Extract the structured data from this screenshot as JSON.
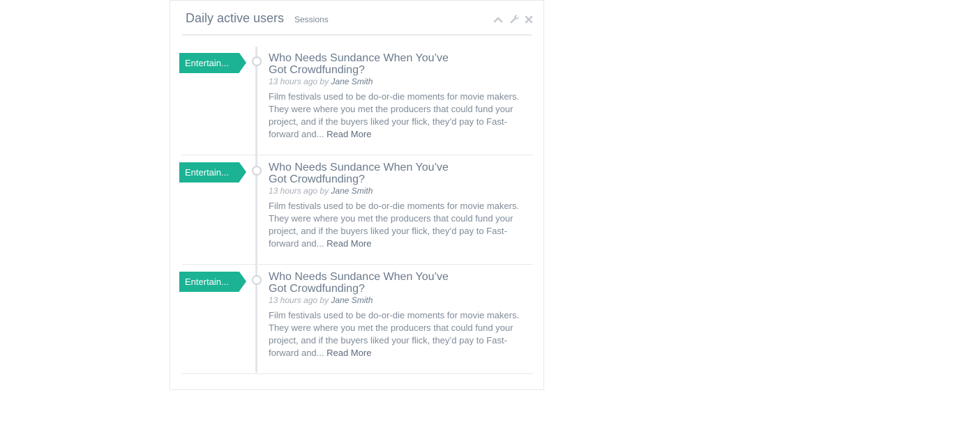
{
  "widget": {
    "title": "Daily active users",
    "subtitle": "Sessions",
    "tools": [
      "chevron-up-icon",
      "wrench-icon",
      "close-icon"
    ]
  },
  "colors": {
    "tag": "#1bb394",
    "text": "#6b7a8c",
    "muted": "#a7aeb6"
  },
  "entries": [
    {
      "tag": "Entertain...",
      "title": "Who Needs Sundance When You’ve Got Crowdfunding?",
      "time": "13 hours ago by ",
      "author": "Jane Smith",
      "text": "Film festivals used to be do-or-die moments for movie makers. They were where you met the producers that could fund your project, and if the buyers liked your flick, they’d pay to Fast-forward and... ",
      "read_more": "Read More"
    },
    {
      "tag": "Entertain...",
      "title": "Who Needs Sundance When You’ve Got Crowdfunding?",
      "time": "13 hours ago by ",
      "author": "Jane Smith",
      "text": "Film festivals used to be do-or-die moments for movie makers. They were where you met the producers that could fund your project, and if the buyers liked your flick, they’d pay to Fast-forward and... ",
      "read_more": "Read More"
    },
    {
      "tag": "Entertain...",
      "title": "Who Needs Sundance When You’ve Got Crowdfunding?",
      "time": "13 hours ago by ",
      "author": "Jane Smith",
      "text": "Film festivals used to be do-or-die moments for movie makers. They were where you met the producers that could fund your project, and if the buyers liked your flick, they’d pay to Fast-forward and... ",
      "read_more": "Read More"
    }
  ]
}
